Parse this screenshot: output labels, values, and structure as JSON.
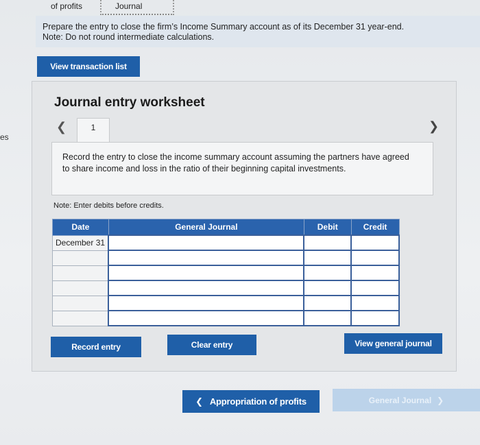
{
  "tabs": [
    {
      "label": "of profits"
    },
    {
      "label": "Journal"
    }
  ],
  "side_text": "es",
  "instructions": {
    "line1": "Prepare the entry to close the firm’s Income Summary account as of its December 31 year-end.",
    "line2": "Note: Do not round intermediate calculations."
  },
  "buttons": {
    "view_transaction_list": "View transaction list",
    "record_entry": "Record entry",
    "clear_entry": "Clear entry",
    "view_general_journal": "View general journal",
    "appropriation_of_profits": "Appropriation of profits",
    "general_journal": "General Journal"
  },
  "worksheet": {
    "title": "Journal entry worksheet",
    "current_page": "1",
    "prev_icon": "chevron-left-icon",
    "next_icon": "chevron-right-icon",
    "record_text": "Record the entry to close the income summary account assuming the partners have agreed to share income and loss in the ratio of their beginning capital investments.",
    "note": "Note: Enter debits before credits."
  },
  "table": {
    "headers": [
      "Date",
      "General Journal",
      "Debit",
      "Credit"
    ],
    "rows": [
      {
        "date": "December 31"
      },
      {
        "date": ""
      },
      {
        "date": ""
      },
      {
        "date": ""
      },
      {
        "date": ""
      },
      {
        "date": ""
      }
    ]
  },
  "colors": {
    "primary_button": "#1f5fa8",
    "table_header": "#2a63ad",
    "disabled_button": "#bcd3ea"
  }
}
